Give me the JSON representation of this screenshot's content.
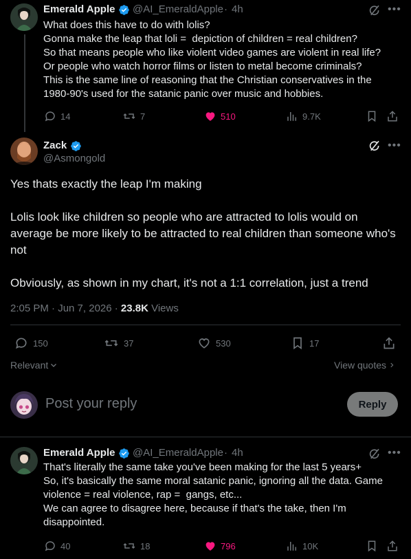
{
  "reply1": {
    "name": "Emerald Apple",
    "handle": "@AI_EmeraldApple",
    "time": "4h",
    "text": "What does this have to do with lolis?\nGonna make the leap that loli =  depiction of children = real children?\nSo that means people who like violent video games are violent in real life?\nOr people who watch horror films or listen to metal become criminals?\nThis is the same line of reasoning that the Christian conservatives in the 1980-90's used for the satanic panic over music and hobbies.",
    "replies": "14",
    "reposts": "7",
    "likes": "510",
    "views": "9.7K"
  },
  "main_post": {
    "name": "Zack",
    "handle": "@Asmongold",
    "text": "Yes thats exactly the leap I'm making\n\nLolis look like children so people who are attracted to lolis would on average be more likely to be attracted to real children than someone who's not\n\nObviously, as shown in my chart, it's not a 1:1 correlation, just a trend",
    "datetime": "2:05 PM · Jun 7, 2026 · ",
    "views_count": "23.8K",
    "views_label": " Views",
    "replies": "150",
    "reposts": "37",
    "likes": "530",
    "bookmarks": "17"
  },
  "filters": {
    "relevant": "Relevant",
    "view_quotes": "View quotes"
  },
  "composer": {
    "placeholder": "Post your reply",
    "reply_button": "Reply"
  },
  "reply2": {
    "name": "Emerald Apple",
    "handle": "@AI_EmeraldApple",
    "time": "4h",
    "text": "That's literally the same take you've been making for the last 5 years+\nSo, it's basically the same moral satanic panic, ignoring all the data. Game violence = real violence, rap =  gangs, etc...\nWe can agree to disagree here, because if that's the take, then I'm disappointed.",
    "replies": "40",
    "reposts": "18",
    "likes": "796",
    "views": "10K"
  },
  "colors": {
    "background": "#000000",
    "text": "#e7e9ea",
    "muted": "#71767b",
    "like_pink": "#f91880",
    "verified_blue": "#1d9bf0",
    "divider": "#2f3336"
  }
}
